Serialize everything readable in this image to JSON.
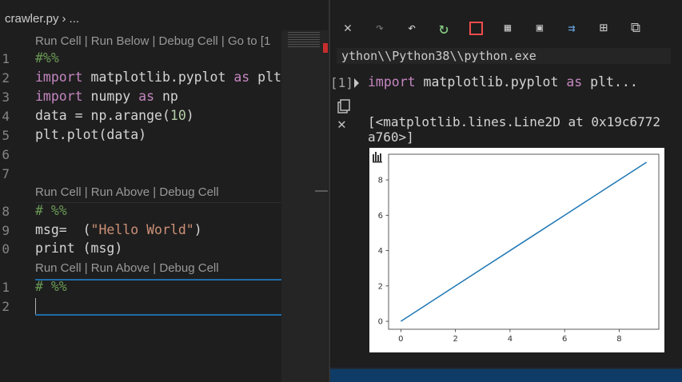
{
  "editor": {
    "breadcrumb": {
      "file": "crawler.py",
      "rest": "..."
    },
    "codelens": [
      "Run Cell | Run Below | Debug Cell | Go to [1",
      "Run Cell | Run Above | Debug Cell",
      "Run Cell | Run Above | Debug Cell"
    ],
    "line_numbers": [
      "1",
      "2",
      "3",
      "4",
      "5",
      "6",
      "7",
      "8",
      "9",
      "0",
      "1",
      "2"
    ],
    "lines": {
      "l1": "#%%",
      "l2_kw": "import",
      "l2_mid": " matplotlib.pyplot ",
      "l2_as": "as",
      "l2_end": " plt",
      "l3_kw": "import",
      "l3_mid": " numpy ",
      "l3_as": "as",
      "l3_end": " np",
      "l4_a": "data = np.arange(",
      "l4_num": "10",
      "l4_b": ")",
      "l5": "plt.plot(data)",
      "l8": "# %%",
      "l9_a": "msg=  (",
      "l9_str": "\"Hello World\"",
      "l9_b": ")",
      "l10": "print (msg)",
      "l11": "# %%"
    }
  },
  "interactive": {
    "toolbar_icons": [
      "close-icon",
      "redo-icon",
      "undo-icon",
      "restart-icon",
      "stop-icon",
      "variables-icon",
      "save-icon",
      "export-icon",
      "expand-all-icon",
      "collapse-all-icon"
    ],
    "toolbar_glyphs": {
      "close": "✕",
      "redo": "↷",
      "undo": "↶",
      "restart": "↻",
      "stop": "",
      "variables": "▦",
      "save": "▣",
      "export": "⇉",
      "expand": "⊞",
      "collapse": "⧉"
    },
    "path": "ython\\\\Python38\\\\python.exe",
    "cell": {
      "count": "[1]",
      "kw": "import",
      "mid": " matplotlib.pyplot ",
      "as": "as",
      "end": " plt..."
    },
    "output_text": "[<matplotlib.lines.Line2D at 0x19c6772\na760>]",
    "clear_glyph": "✕"
  },
  "colors": {
    "line": "#1f77b4",
    "accent": "#1f6ca8",
    "restart": "#89d185",
    "stop": "#f14c4c"
  },
  "chart_data": {
    "type": "line",
    "x": [
      0,
      1,
      2,
      3,
      4,
      5,
      6,
      7,
      8,
      9
    ],
    "values": [
      0,
      1,
      2,
      3,
      4,
      5,
      6,
      7,
      8,
      9
    ],
    "xticks": [
      "0",
      "2",
      "4",
      "6",
      "8"
    ],
    "yticks": [
      "0",
      "2",
      "4",
      "6",
      "8"
    ],
    "xlim": [
      -0.45,
      9.45
    ],
    "ylim": [
      -0.45,
      9.45
    ],
    "grid": false
  }
}
